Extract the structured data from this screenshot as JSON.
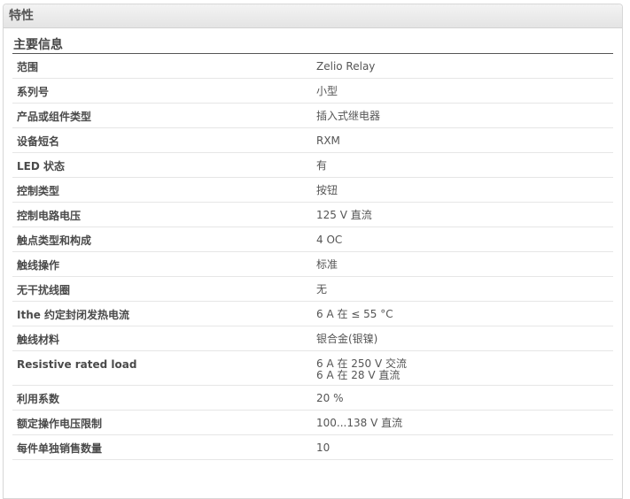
{
  "panel": {
    "title": "特性"
  },
  "section": {
    "title": "主要信息"
  },
  "rows": [
    {
      "name": "范围",
      "values": [
        "Zelio Relay"
      ]
    },
    {
      "name": "系列号",
      "values": [
        "小型"
      ]
    },
    {
      "name": "产品或组件类型",
      "values": [
        "插入式继电器"
      ]
    },
    {
      "name": "设备短名",
      "values": [
        "RXM"
      ]
    },
    {
      "name": "LED 状态",
      "values": [
        "有"
      ]
    },
    {
      "name": "控制类型",
      "values": [
        "按钮"
      ]
    },
    {
      "name": "控制电路电压",
      "values": [
        "125 V 直流"
      ]
    },
    {
      "name": "触点类型和构成",
      "values": [
        "4 OC"
      ]
    },
    {
      "name": "触线操作",
      "values": [
        "标准"
      ]
    },
    {
      "name": "无干扰线圈",
      "values": [
        "无"
      ]
    },
    {
      "name": "Ithe 约定封闭发热电流",
      "values": [
        "6 A 在 ≤ 55 °C"
      ]
    },
    {
      "name": "触线材料",
      "values": [
        "银合金(银镍)"
      ]
    },
    {
      "name": "Resistive rated load",
      "values": [
        "6 A 在 250 V 交流",
        "6 A 在 28 V 直流"
      ]
    },
    {
      "name": "利用系数",
      "values": [
        "20 %"
      ]
    },
    {
      "name": "额定操作电压限制",
      "values": [
        "100...138 V 直流"
      ]
    },
    {
      "name": "每件单独销售数量",
      "values": [
        "10"
      ]
    }
  ]
}
